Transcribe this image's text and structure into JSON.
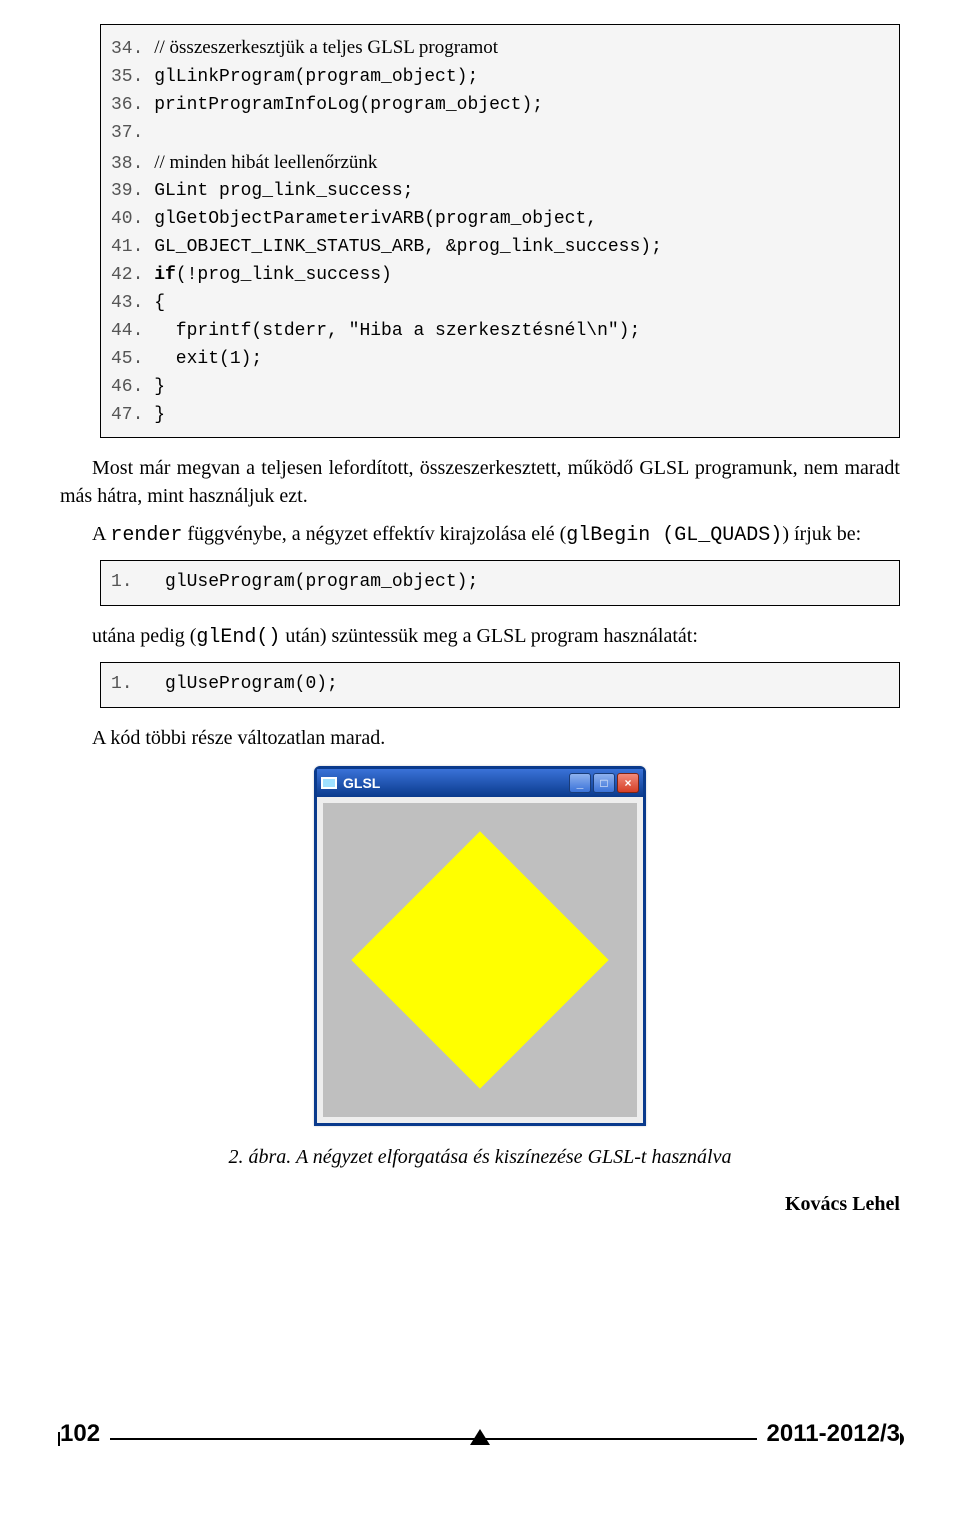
{
  "code1": {
    "lines": [
      {
        "n": "34.",
        "type": "comment",
        "t": "// összeszerkesztjük a teljes GLSL programot"
      },
      {
        "n": "35.",
        "type": "code",
        "t": "glLinkProgram(program_object);"
      },
      {
        "n": "36.",
        "type": "code",
        "t": "printProgramInfoLog(program_object);"
      },
      {
        "n": "37.",
        "type": "code",
        "t": ""
      },
      {
        "n": "38.",
        "type": "comment",
        "t": "// minden hibát leellenőrzünk"
      },
      {
        "n": "39.",
        "type": "code",
        "t": "GLint prog_link_success;"
      },
      {
        "n": "40.",
        "type": "code",
        "t": "glGetObjectParameterivARB(program_object,"
      },
      {
        "n": "41.",
        "type": "code",
        "t": "GL_OBJECT_LINK_STATUS_ARB, &prog_link_success);"
      },
      {
        "n": "42.",
        "type": "codekw",
        "kw": "if",
        "t": "(!prog_link_success)"
      },
      {
        "n": "43.",
        "type": "code",
        "t": "{"
      },
      {
        "n": "44.",
        "type": "code",
        "t": "  fprintf(stderr, \"Hiba a szerkesztésnél\\n\");"
      },
      {
        "n": "45.",
        "type": "code",
        "t": "  exit(1);"
      },
      {
        "n": "46.",
        "type": "code",
        "t": "}"
      },
      {
        "n": "47.",
        "type": "code",
        "t": "}"
      }
    ]
  },
  "para1": "Most már megvan a teljesen lefordított, összeszerkesztett, működő GLSL programunk, nem maradt más hátra, mint használjuk ezt.",
  "para2_a": "A ",
  "para2_b": "render",
  "para2_c": " függvénybe, a négyzet effektív kirajzolása elé (",
  "para2_d": "glBegin (GL_QUADS)",
  "para2_e": ") írjuk be:",
  "code2": {
    "n": "1.",
    "t": "   glUseProgram(program_object);"
  },
  "para3_a": "utána pedig (",
  "para3_b": "glEnd()",
  "para3_c": "  után) szüntessük meg a GLSL program használatát:",
  "code3": {
    "n": "1.",
    "t": "   glUseProgram(0);"
  },
  "para4": "A kód többi része változatlan marad.",
  "glslWindow": {
    "title": "GLSL"
  },
  "caption_a": "2. ábra.",
  "caption_b": " A négyzet elforgatása és kiszínezése GLSL-t használva",
  "author": "Kovács Lehel",
  "footer": {
    "pageNum": "102",
    "issue": "2011-2012/3"
  }
}
